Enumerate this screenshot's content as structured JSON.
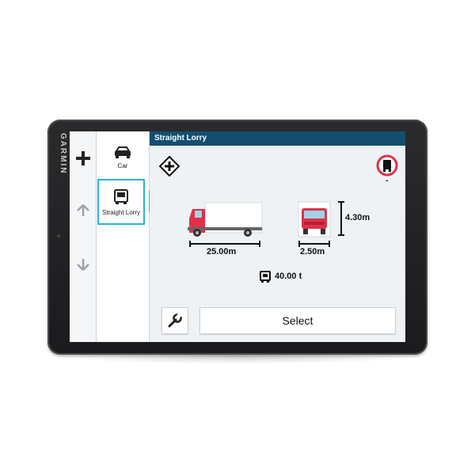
{
  "device": {
    "brand": "GARMIN"
  },
  "profiles": {
    "items": [
      {
        "label": "Car",
        "icon": "car-icon",
        "selected": false
      },
      {
        "label": "Straight Lorry",
        "icon": "lorry-icon",
        "selected": true
      }
    ]
  },
  "header": {
    "title": "Straight Lorry"
  },
  "vehicle": {
    "length": "25.00m",
    "width": "2.50m",
    "height": "4.30m",
    "weight": "40.00 t",
    "restriction_value": "-"
  },
  "actions": {
    "select_label": "Select"
  },
  "colors": {
    "accent": "#2bb3d6",
    "titlebar": "#134e70",
    "truck_red": "#e0304a"
  }
}
